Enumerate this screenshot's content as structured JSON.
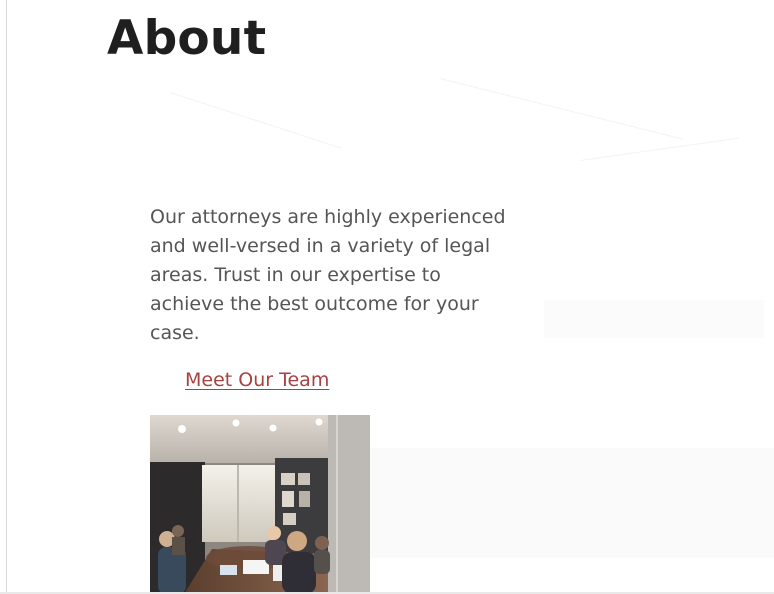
{
  "page": {
    "title": "About"
  },
  "about": {
    "description": "Our attorneys are highly experienced and well-versed in a variety of legal areas. Trust in our expertise to achieve the best outcome for your case.",
    "link_label": "Meet Our Team"
  },
  "colors": {
    "heading": "#1f1f1f",
    "body": "#555555",
    "link": "#a94141"
  },
  "image": {
    "name": "conference-room-photo"
  }
}
